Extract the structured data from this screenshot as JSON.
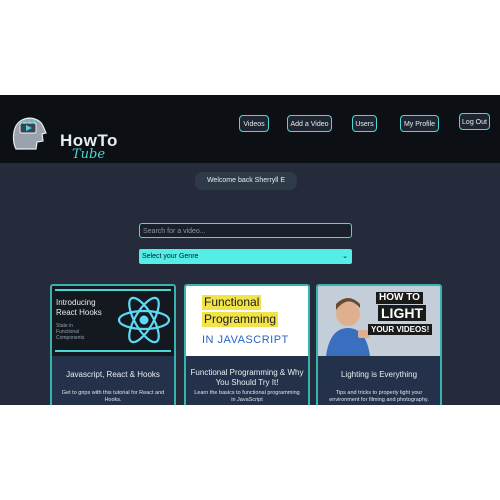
{
  "header": {
    "logo_main": "HowTo",
    "logo_sub": "Tube",
    "nav": [
      "Videos",
      "Add a Video",
      "Users",
      "My Profile",
      "Log Out"
    ]
  },
  "welcome": "Welcome back Sherryll E",
  "search": {
    "placeholder": "Search for a video..."
  },
  "genre": {
    "selected": "Select your Genre"
  },
  "cards": [
    {
      "thumb_title": "Introducing React Hooks",
      "thumb_sub": "State in Functional Components",
      "title": "Javascript, React & Hooks",
      "desc": "Get to grips with this tutorial for React and Hooks."
    },
    {
      "thumb_line1": "Functional",
      "thumb_line2": "Programming",
      "thumb_line3": "IN JAVASCRIPT",
      "title": "Functional Programming & Why You Should Try It!",
      "desc": "Learn the basics to functional programming in JavaScript"
    },
    {
      "thumb_line1": "HOW TO",
      "thumb_line2": "LIGHT",
      "thumb_line3": "YOUR VIDEOS!",
      "title": "Lighting is Everything",
      "desc": "Tips and tricks to properly light your environment for filming and photography."
    }
  ],
  "colors": {
    "accent": "#4ad8d4",
    "header_bg": "#0c0f14",
    "page_bg": "#252b3a",
    "select_bg": "#54eee7"
  }
}
